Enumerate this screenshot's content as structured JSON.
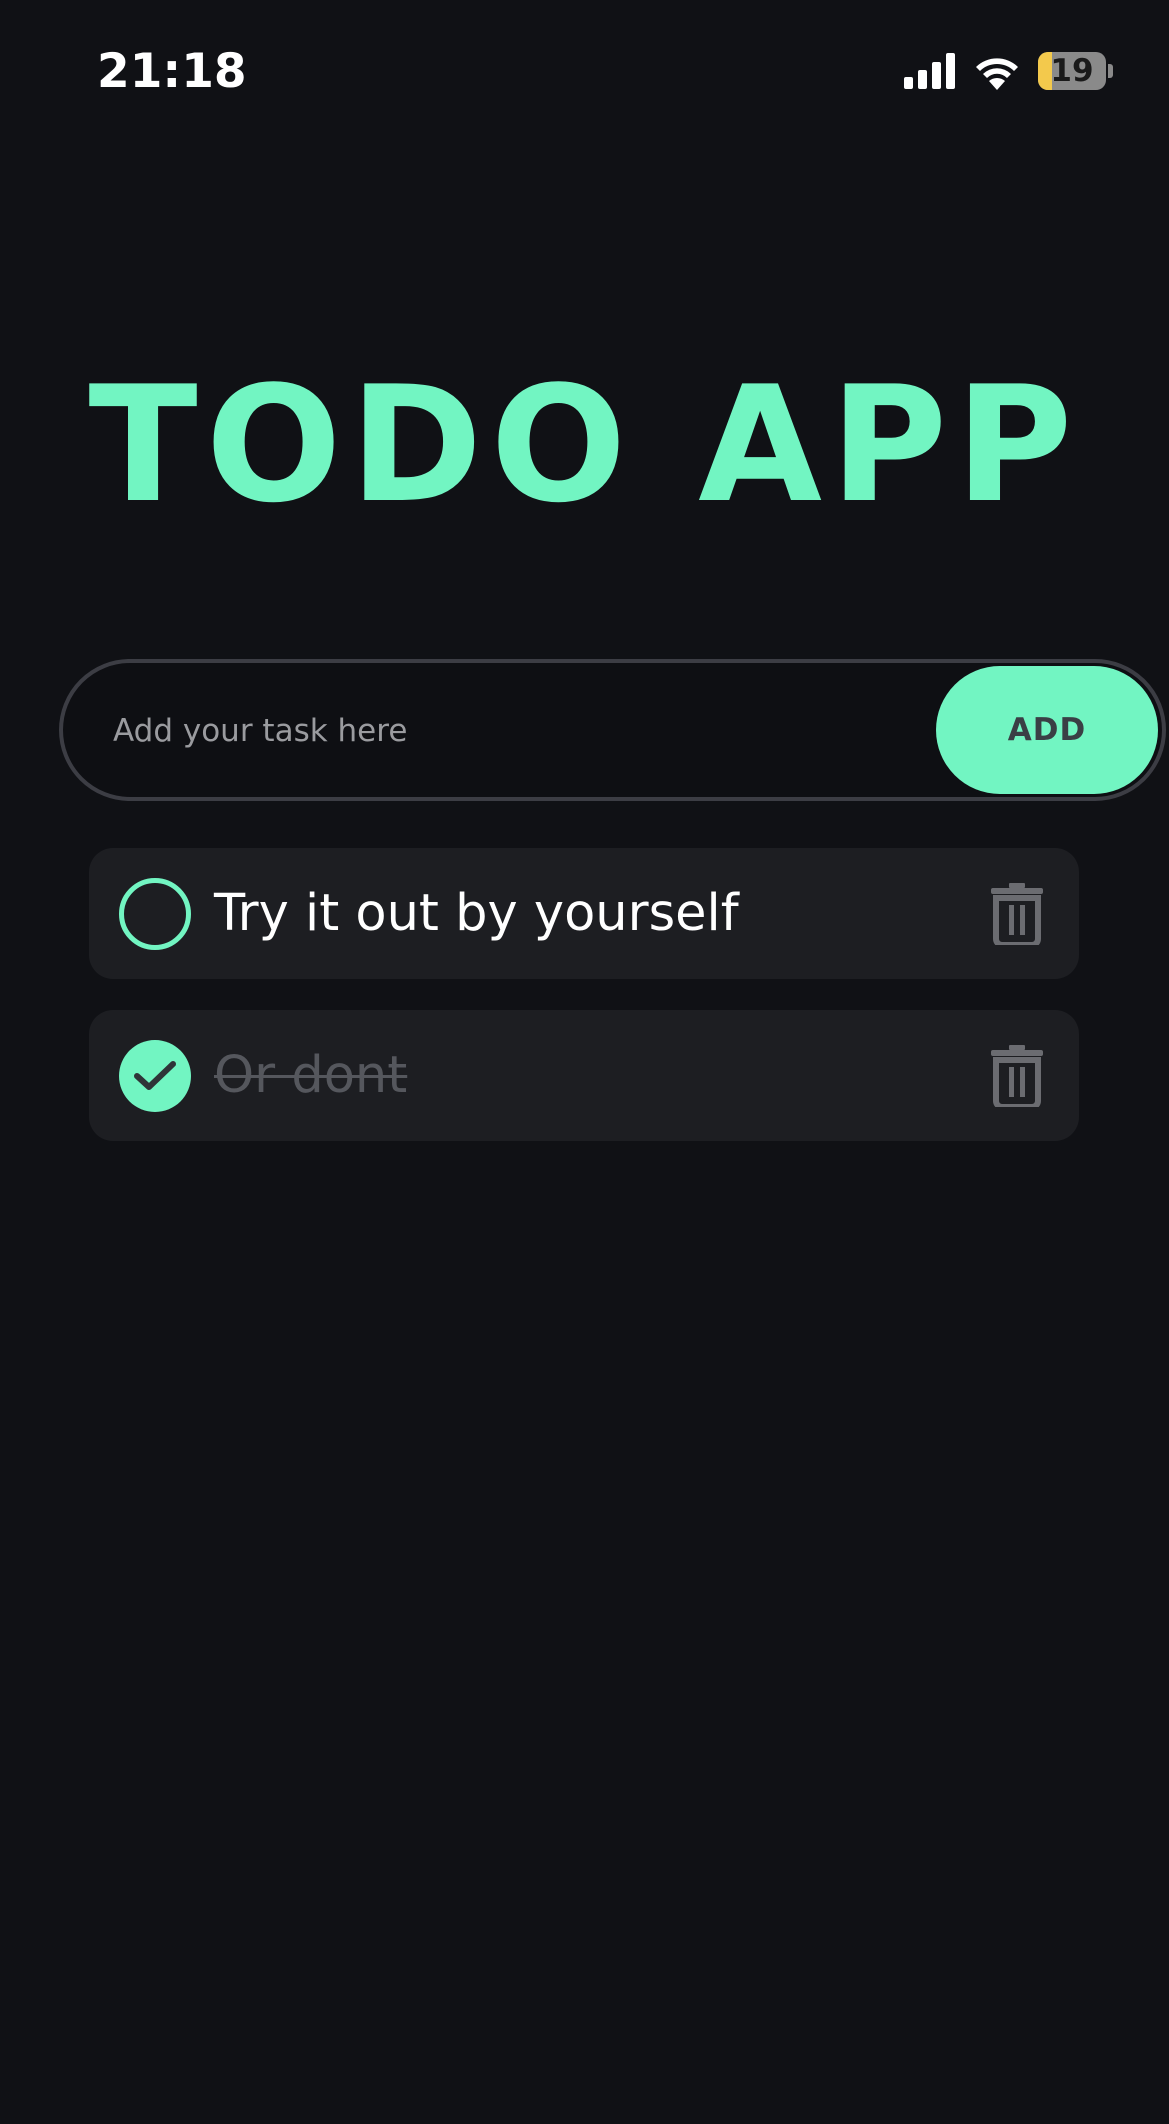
{
  "status_bar": {
    "time": "21:18",
    "battery_percent": "19",
    "signal_icon": "cellular-signal-icon",
    "wifi_icon": "wifi-icon",
    "battery_icon": "battery-icon"
  },
  "header": {
    "title": "TODO APP"
  },
  "task_input": {
    "value": "",
    "placeholder": "Add your task here",
    "add_label": "ADD"
  },
  "tasks": [
    {
      "text": "Try it out by yourself",
      "completed": false,
      "delete_icon": "trash-icon"
    },
    {
      "text": "Or dont",
      "completed": true,
      "delete_icon": "trash-icon"
    }
  ],
  "colors": {
    "background": "#101115",
    "accent": "#72f5c2",
    "card": "#1d1e22",
    "input_border": "#3c3d44",
    "muted_text": "#9a9b9f",
    "icon_gray": "#6b6c71"
  }
}
